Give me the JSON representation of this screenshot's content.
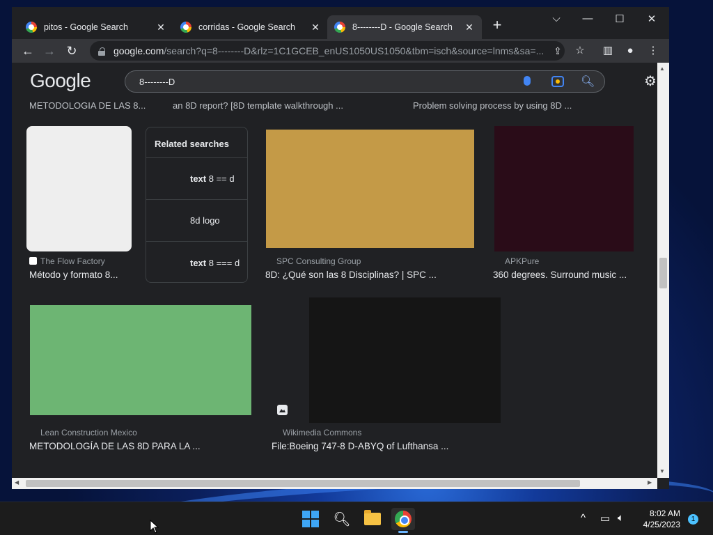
{
  "browser": {
    "tabs": [
      {
        "title": "pitos - Google Search",
        "close": "✕",
        "active": false
      },
      {
        "title": "corridas - Google Search",
        "close": "✕",
        "active": false
      },
      {
        "title": "8--------D - Google Search",
        "close": "✕",
        "active": true
      }
    ],
    "new_tab": "+",
    "window_controls": {
      "tab_search": "⌵",
      "minimize": "—",
      "maximize": "☐",
      "close": "✕"
    },
    "nav": {
      "back": "←",
      "forward": "→",
      "reload": "↻"
    },
    "address": {
      "domain": "google.com",
      "path": "/search?q=8--------D&rlz=1C1GCEB_enUS1050US1050&tbm=isch&source=lnms&sa=..."
    },
    "toolbar_icons": [
      "share-icon",
      "star-icon",
      "side-panel-icon",
      "profile-icon",
      "menu-icon"
    ]
  },
  "google": {
    "logo": "Google",
    "query": "8--------D",
    "cut_titles": [
      "METODOLOGIA DE LAS 8...",
      "an 8D report? [8D template walkthrough ...",
      "Problem solving process by using 8D ..."
    ],
    "results": [
      {
        "source": "The Flow Factory",
        "title": "Método y formato 8...",
        "color": "#eeeeee"
      },
      {
        "source": "SPC Consulting Group",
        "title": "8D: ¿Qué son las 8 Disciplinas? | SPC ...",
        "color": "#c49a47"
      },
      {
        "source": "APKPure",
        "title": "360 degrees. Surround music ...",
        "color": "#2a0c18"
      },
      {
        "source": "Lean Construction Mexico",
        "title": "METODOLOGÍA DE LAS 8D PARA LA ...",
        "color": "#6db573"
      },
      {
        "source": "Wikimedia Commons",
        "title": "File:Boeing 747-8 D-ABYQ of Lufthansa ...",
        "color": "#151515"
      }
    ],
    "related": {
      "header": "Related searches",
      "items": [
        {
          "bold": "text",
          "rest": " 8 == d"
        },
        {
          "bold": "",
          "rest": "8d logo"
        },
        {
          "bold": "text",
          "rest": " 8 === d"
        }
      ]
    }
  },
  "taskbar": {
    "time": "8:02 AM",
    "date": "4/25/2023",
    "notifications": "1",
    "tray_expand": "^"
  }
}
